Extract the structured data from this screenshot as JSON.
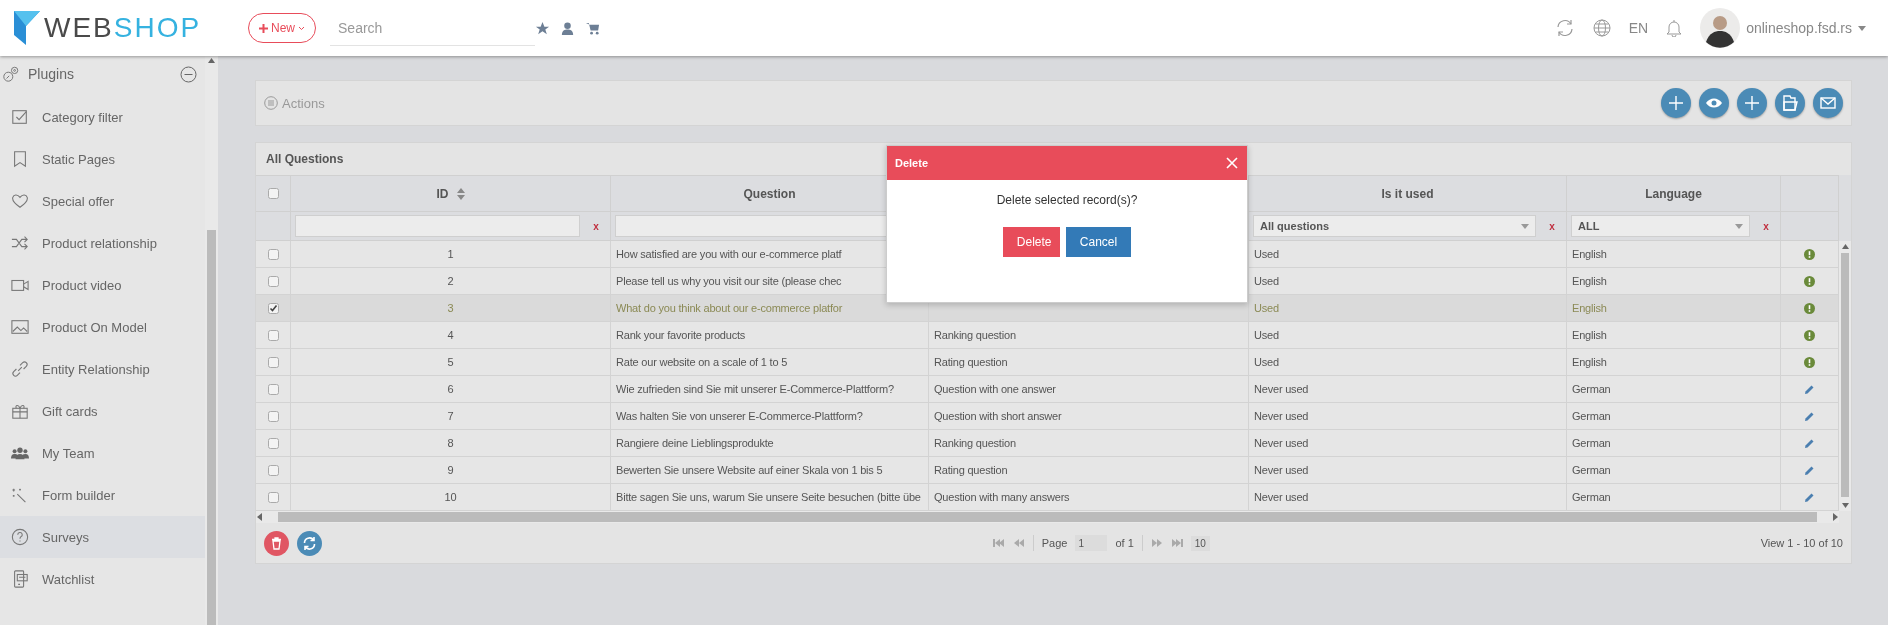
{
  "header": {
    "logo": {
      "part_1": "WEB",
      "part_2": "SHOP"
    },
    "new_button": "New",
    "search": {
      "placeholder": "Search"
    },
    "language": "EN",
    "user": "onlineshop.fsd.rs"
  },
  "sidebar": {
    "section": {
      "label": "Plugins",
      "expanded": true
    },
    "items": [
      {
        "label": "Category filter",
        "kind": "check",
        "selected": false
      },
      {
        "label": "Static Pages",
        "kind": "bookmark",
        "selected": false
      },
      {
        "label": "Special offer",
        "kind": "heart",
        "selected": false
      },
      {
        "label": "Product relationship",
        "kind": "shuffle",
        "selected": false
      },
      {
        "label": "Product video",
        "kind": "video",
        "selected": false
      },
      {
        "label": "Product On Model",
        "kind": "image",
        "selected": false
      },
      {
        "label": "Entity Relationship",
        "kind": "link",
        "selected": false
      },
      {
        "label": "Gift cards",
        "kind": "gift",
        "selected": false
      },
      {
        "label": "My Team",
        "kind": "team",
        "selected": false
      },
      {
        "label": "Form builder",
        "kind": "wand",
        "selected": false
      },
      {
        "label": "Surveys",
        "kind": "question",
        "selected": true
      },
      {
        "label": "Watchlist",
        "kind": "watch",
        "selected": false
      }
    ]
  },
  "actions": {
    "title": "Actions",
    "buttons": [
      {
        "kind": "add"
      },
      {
        "kind": "view"
      },
      {
        "kind": "add"
      },
      {
        "kind": "folder"
      },
      {
        "kind": "mail"
      }
    ]
  },
  "table": {
    "title": "All Questions",
    "header_checked": false,
    "columns": {
      "id": "ID",
      "question": "Question",
      "is_it_used": "Is it used",
      "language": "Language"
    },
    "filters": {
      "id_clear": "x",
      "is_it_used": "All questions",
      "is_it_used_clear": "x",
      "language": "ALL",
      "language_clear": "x"
    },
    "rows": [
      {
        "selected": false,
        "id": "1",
        "question": "How satisfied are you with our e-commerce platf",
        "is_it_used": "Used",
        "language": "English",
        "kind": "info"
      },
      {
        "selected": false,
        "id": "2",
        "question": "Please tell us why you visit our site (please chec",
        "is_it_used": "Used",
        "language": "English",
        "kind": "info"
      },
      {
        "selected": true,
        "id": "3",
        "question": "What do you think about our e-commerce platfor",
        "is_it_used": "Used",
        "language": "English",
        "kind": "info"
      },
      {
        "selected": false,
        "id": "4",
        "question": "Rank your favorite products",
        "column_3": "Ranking question",
        "is_it_used": "Used",
        "language": "English",
        "kind": "info"
      },
      {
        "selected": false,
        "id": "5",
        "question": "Rate our website on a scale of 1 to 5",
        "column_3": "Rating question",
        "is_it_used": "Used",
        "language": "English",
        "kind": "info"
      },
      {
        "selected": false,
        "id": "6",
        "question": "Wie zufrieden sind Sie mit unserer E-Commerce-Plattform?",
        "column_3": "Question with one answer",
        "is_it_used": "Never used",
        "language": "German",
        "kind": "edit"
      },
      {
        "selected": false,
        "id": "7",
        "question": "Was halten Sie von unserer E-Commerce-Plattform?",
        "column_3": "Question with short answer",
        "is_it_used": "Never used",
        "language": "German",
        "kind": "edit"
      },
      {
        "selected": false,
        "id": "8",
        "question": "Rangiere deine Lieblingsprodukte",
        "column_3": "Ranking question",
        "is_it_used": "Never used",
        "language": "German",
        "kind": "edit"
      },
      {
        "selected": false,
        "id": "9",
        "question": "Bewerten Sie unsere Website auf einer Skala von 1 bis 5",
        "column_3": "Rating question",
        "is_it_used": "Never used",
        "language": "German",
        "kind": "edit"
      },
      {
        "selected": false,
        "id": "10",
        "question": "Bitte sagen Sie uns, warum Sie unsere Seite besuchen (bitte übe",
        "column_3": "Question with many answers",
        "is_it_used": "Never used",
        "language": "German",
        "kind": "edit"
      }
    ],
    "pager": {
      "page_label": "Page",
      "page": "1",
      "of": "of 1",
      "page_size": "10",
      "view": "View 1 - 10 of 10"
    }
  },
  "dialog": {
    "title": "Delete",
    "message": "Delete selected record(s)?",
    "buttons": [
      {
        "label": "Delete",
        "kind": "danger"
      },
      {
        "label": "Cancel",
        "kind": "primary"
      }
    ]
  }
}
